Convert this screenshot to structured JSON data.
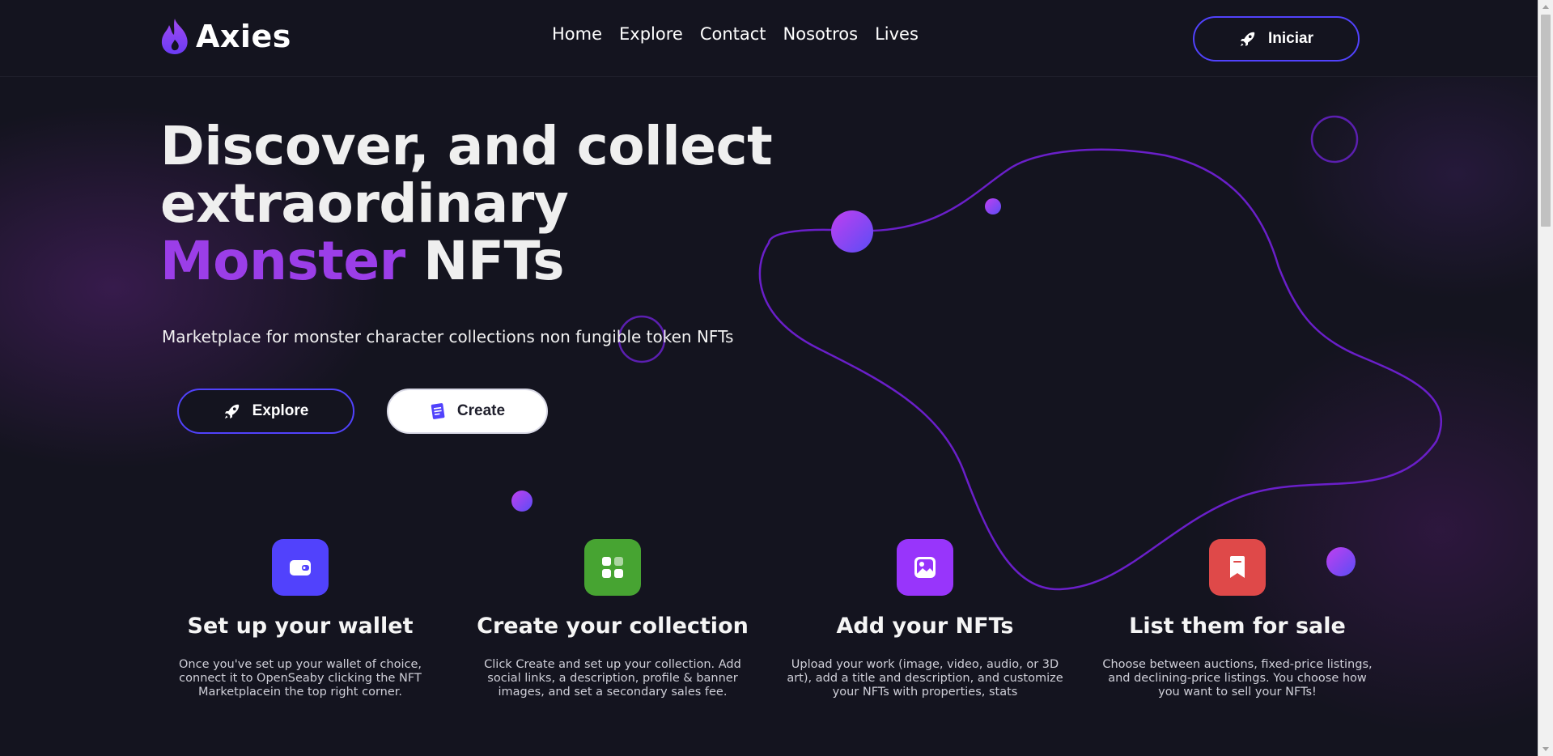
{
  "header": {
    "logo_text": "Axies",
    "nav": [
      "Home",
      "Explore",
      "Contact",
      "Nosotros",
      "Lives"
    ],
    "start_label": "Iniciar"
  },
  "hero": {
    "title_line1": "Discover, and collect",
    "title_line2": "extraordinary",
    "title_accent": "Monster",
    "title_rest": "NFTs",
    "subtitle": "Marketplace for monster character collections non fungible token NFTs",
    "explore_label": "Explore",
    "create_label": "Create"
  },
  "steps": [
    {
      "title": "Set up your wallet",
      "description": "Once you've set up your wallet of choice, connect it to OpenSeaby clicking the NFT Marketplacein the top right corner.",
      "icon": "wallet-icon",
      "color": "#5142fc"
    },
    {
      "title": "Create your collection",
      "description": "Click Create and set up your collection. Add social links, a description, profile & banner images, and set a secondary sales fee.",
      "icon": "grid-icon",
      "color": "#47a432"
    },
    {
      "title": "Add your NFTs",
      "description": "Upload your work (image, video, audio, or 3D art), add a title and description, and customize your NFTs with properties, stats",
      "icon": "image-icon",
      "color": "#9835fb"
    },
    {
      "title": "List them for sale",
      "description": "Choose between auctions, fixed-price listings, and declining-price listings. You choose how you want to sell your NFTs!",
      "icon": "bookmark-icon",
      "color": "#df4949"
    }
  ],
  "colors": {
    "background": "#14141f",
    "primary": "#5142fc",
    "accent_purple": "#9b3ee8",
    "curve": "#6a1fc9"
  }
}
